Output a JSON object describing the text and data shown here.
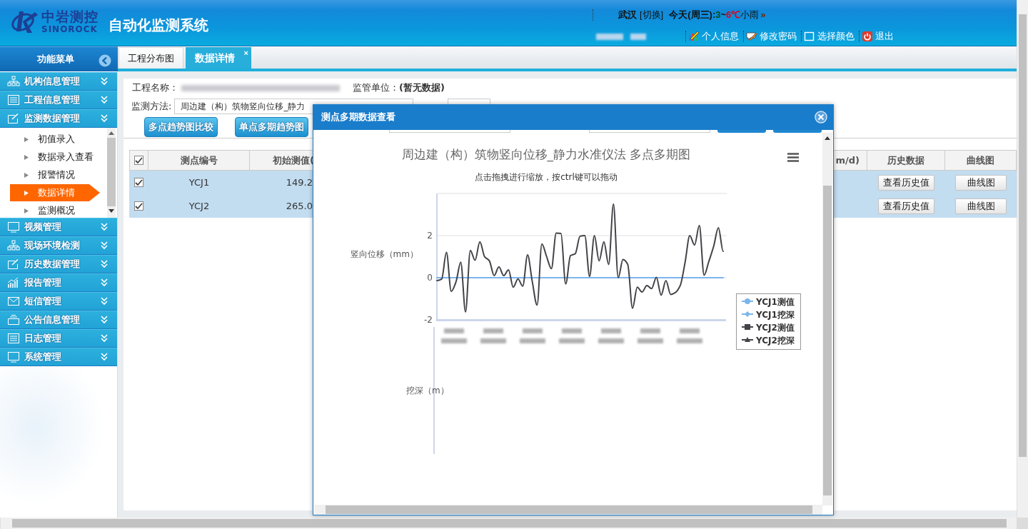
{
  "header": {
    "logo_cn": "中岩测控",
    "logo_en": "SINOROCK",
    "title": "自动化监测系统",
    "weather": {
      "city": "武汉",
      "switch_link": "[切换]",
      "today": "今天(周三):",
      "low": "3",
      "separator": "~",
      "high": "6℃",
      "condition": "小雨",
      "more": "»"
    },
    "links": [
      {
        "label": "个人信息",
        "kind": "profile"
      },
      {
        "label": "修改密码",
        "kind": "password"
      },
      {
        "label": "选择颜色",
        "kind": "color"
      },
      {
        "label": "退出",
        "kind": "logout"
      }
    ]
  },
  "sidebar": {
    "title": "功能菜单",
    "items": [
      {
        "label": "机构信息管理",
        "kind": "org"
      },
      {
        "label": "工程信息管理",
        "kind": "list"
      },
      {
        "label": "监测数据管理",
        "kind": "edit",
        "children": [
          {
            "label": "初值录入",
            "selected": false
          },
          {
            "label": "数据录入查看",
            "selected": false
          },
          {
            "label": "报警情况",
            "selected": false
          },
          {
            "label": "数据详情",
            "selected": true
          },
          {
            "label": "监测概况",
            "selected": false
          }
        ]
      },
      {
        "label": "视频管理",
        "kind": "monitor"
      },
      {
        "label": "现场环境检测",
        "kind": "org"
      },
      {
        "label": "历史数据管理",
        "kind": "edit"
      },
      {
        "label": "报告管理",
        "kind": "chart"
      },
      {
        "label": "短信管理",
        "kind": "mail"
      },
      {
        "label": "公告信息管理",
        "kind": "tray"
      },
      {
        "label": "日志管理",
        "kind": "list"
      },
      {
        "label": "系统管理",
        "kind": "monitor"
      }
    ]
  },
  "tabs": [
    {
      "label": "工程分布图",
      "selected": false
    },
    {
      "label": "数据详情",
      "selected": true,
      "close": "×"
    }
  ],
  "form": {
    "project_label": "工程名称：",
    "supervisor_label": "监管单位：",
    "supervisor_value": "(暂无数据)",
    "method_label": "监测方法:",
    "method_value": "周边建（构）筑物竖向位移_静力"
  },
  "buttons": [
    "多点趋势图比较",
    "单点多期趋势图"
  ],
  "table": {
    "all_checked": true,
    "columns": [
      "测点编号",
      "初始测值(",
      "m/d)",
      "历史数据",
      "曲线图"
    ],
    "rows": [
      {
        "checked": true,
        "selected": true,
        "point": "YCJ1",
        "initial": "149.2",
        "history_button": "查看历史值",
        "curve_button": "曲线图"
      },
      {
        "checked": true,
        "selected": true,
        "point": "YCJ2",
        "initial": "265.0",
        "history_button": "查看历史值",
        "curve_button": "曲线图"
      }
    ]
  },
  "modal": {
    "title": "测点多期数据查看",
    "subtitle": "点击拖拽进行缩放，按ctrl键可以拖动",
    "secondary_axis_label": "挖深（m）",
    "legend_markers": [
      {
        "kind": "circle"
      },
      {
        "kind": "diamond"
      },
      {
        "kind": "square"
      },
      {
        "kind": "triangle"
      }
    ],
    "chart_data": {
      "type": "line",
      "title": "周边建（构）筑物竖向位移_静力水准仪法 多点多期图",
      "ylabel": "竖向位移（mm）",
      "ylim": [
        -2,
        4
      ],
      "yticks": [
        -2,
        0,
        2
      ],
      "legend": "right",
      "series": [
        {
          "name": "YCJ1测值",
          "color": "#7cb5ec",
          "values": [
            0,
            0,
            0,
            0,
            0,
            0,
            0,
            0,
            0,
            0,
            0,
            0,
            0,
            0,
            0,
            0,
            0,
            0,
            0,
            0,
            0,
            0,
            0,
            0,
            0,
            0,
            0,
            0,
            0,
            0,
            0,
            0,
            0,
            0,
            0,
            0,
            0,
            0,
            0,
            0,
            0,
            0,
            0,
            0,
            0,
            0,
            0,
            0,
            0,
            0,
            0,
            0,
            0,
            0,
            0,
            0,
            0,
            0,
            0,
            0,
            0
          ]
        },
        {
          "name": "YCJ1挖深",
          "color": "#7cb5ec",
          "values": [
            null,
            null,
            null,
            null,
            null,
            null,
            null,
            null,
            null,
            null,
            null,
            null,
            null,
            null,
            null,
            null,
            null,
            null,
            null,
            null,
            null,
            null,
            null,
            null,
            null,
            null,
            null,
            null,
            null,
            null,
            null,
            null,
            null,
            null,
            null,
            null,
            null,
            null,
            null,
            null,
            null,
            null,
            null,
            null,
            null,
            null,
            null,
            null,
            null,
            null,
            null,
            null,
            null,
            null,
            null,
            null,
            null,
            null,
            null,
            null,
            null
          ]
        },
        {
          "name": "YCJ2测值",
          "color": "#434348",
          "values": [
            -0.14,
            -0.06,
            1.2,
            -0.65,
            -0.2,
            0.74,
            -1.63,
            1.3,
            0.83,
            1.7,
            1.0,
            0.8,
            0.1,
            0.52,
            0.1,
            0.37,
            -0.45,
            -0.06,
            -0.4,
            1.08,
            -0.2,
            -1.3,
            1.6,
            1.0,
            0.43,
            2.12,
            2.1,
            -0.3,
            1.05,
            1.14,
            1.97,
            2.0,
            0.06,
            2.0,
            0.8,
            1.7,
            0.63,
            3.5,
            0,
            0.86,
            0.63,
            -1.45,
            -0.45,
            -0.68,
            -0.37,
            -0.52,
            0.02,
            -0.83,
            -0.14,
            -0.8,
            -0.7,
            -0.37,
            0.7,
            2.0,
            1.55,
            2.48,
            0.12,
            0.78,
            1.48,
            2.37,
            1.25
          ]
        },
        {
          "name": "YCJ2挖深",
          "color": "#434348",
          "values": [
            null,
            null,
            null,
            null,
            null,
            null,
            null,
            null,
            null,
            null,
            null,
            null,
            null,
            null,
            null,
            null,
            null,
            null,
            null,
            null,
            null,
            null,
            null,
            null,
            null,
            null,
            null,
            null,
            null,
            null,
            null,
            null,
            null,
            null,
            null,
            null,
            null,
            null,
            null,
            null,
            null,
            null,
            null,
            null,
            null,
            null,
            null,
            null,
            null,
            null,
            null,
            null,
            null,
            null,
            null,
            null,
            null,
            null,
            null,
            null,
            null
          ]
        }
      ]
    }
  }
}
